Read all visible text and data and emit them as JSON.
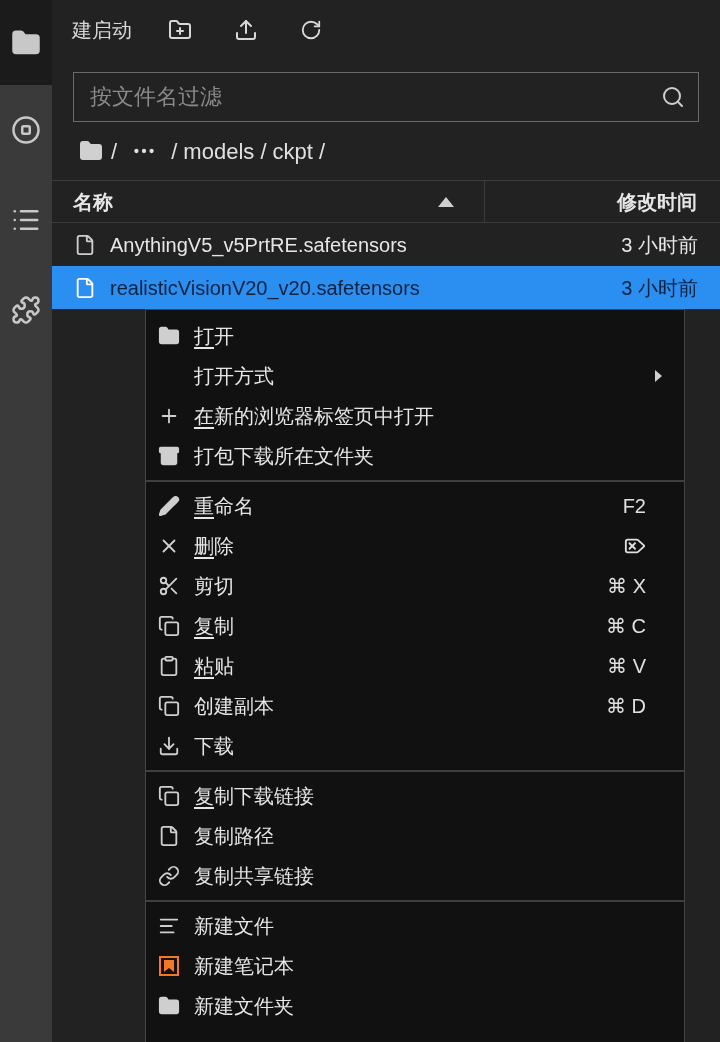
{
  "sidebar": {
    "items": [
      {
        "selected": true
      },
      {
        "selected": false
      },
      {
        "selected": false
      },
      {
        "selected": false
      }
    ]
  },
  "toolbar": {
    "launcher_label": "建启动"
  },
  "filter": {
    "placeholder": "按文件名过滤"
  },
  "breadcrumb": {
    "parts": [
      "/",
      "/ models / ckpt /"
    ]
  },
  "table": {
    "columns": [
      {
        "label": "名称",
        "sorted": true
      },
      {
        "label": "修改时间",
        "sorted": false
      }
    ],
    "rows": [
      {
        "name": "AnythingV5_v5PrtRE.safetensors",
        "modified": "3 小时前",
        "selected": false
      },
      {
        "name": "realisticVisionV20_v20.safetensors",
        "modified": "3 小时前",
        "selected": true
      }
    ]
  },
  "context_menu": {
    "sections": [
      [
        {
          "label": "打开",
          "underlined": true
        },
        {
          "label": "打开方式",
          "submenu": true
        },
        {
          "label": "在新的浏览器标签页中打开",
          "underlined": true
        },
        {
          "label": "打包下载所在文件夹"
        }
      ],
      [
        {
          "label": "重命名",
          "underlined": true,
          "shortcut": "F2"
        },
        {
          "label": "删除",
          "underlined": true,
          "shortcut_icon": true
        },
        {
          "label": "剪切",
          "shortcut": "⌘ X"
        },
        {
          "label": "复制",
          "underlined": true,
          "shortcut": "⌘ C"
        },
        {
          "label": "粘贴",
          "underlined": true,
          "shortcut": "⌘ V"
        },
        {
          "label": "创建副本",
          "shortcut": "⌘ D"
        },
        {
          "label": "下载"
        }
      ],
      [
        {
          "label": "复制下载链接",
          "underlined": true
        },
        {
          "label": "复制路径"
        },
        {
          "label": "复制共享链接"
        }
      ],
      [
        {
          "label": "新建文件"
        },
        {
          "label": "新建笔记本"
        },
        {
          "label": "新建文件夹"
        }
      ]
    ]
  }
}
